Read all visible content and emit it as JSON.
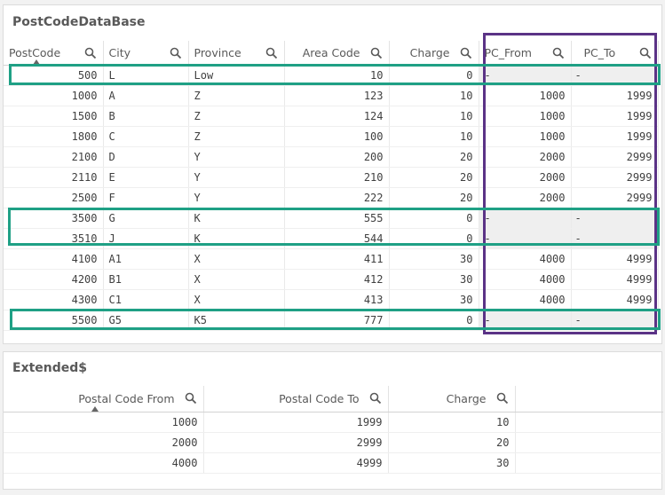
{
  "panel1": {
    "title": "PostCodeDataBase",
    "columns": [
      "PostCode",
      "City",
      "Province",
      "Area Code",
      "Charge",
      "PC_From",
      "PC_To"
    ],
    "rows": [
      [
        "500",
        "L",
        "Low",
        "10",
        "0",
        "-",
        "-"
      ],
      [
        "1000",
        "A",
        "Z",
        "123",
        "10",
        "1000",
        "1999"
      ],
      [
        "1500",
        "B",
        "Z",
        "124",
        "10",
        "1000",
        "1999"
      ],
      [
        "1800",
        "C",
        "Z",
        "100",
        "10",
        "1000",
        "1999"
      ],
      [
        "2100",
        "D",
        "Y",
        "200",
        "20",
        "2000",
        "2999"
      ],
      [
        "2110",
        "E",
        "Y",
        "210",
        "20",
        "2000",
        "2999"
      ],
      [
        "2500",
        "F",
        "Y",
        "222",
        "20",
        "2000",
        "2999"
      ],
      [
        "3500",
        "G",
        "K",
        "555",
        "0",
        "-",
        "-"
      ],
      [
        "3510",
        "J",
        "K",
        "544",
        "0",
        "-",
        "-"
      ],
      [
        "4100",
        "A1",
        "X",
        "411",
        "30",
        "4000",
        "4999"
      ],
      [
        "4200",
        "B1",
        "X",
        "412",
        "30",
        "4000",
        "4999"
      ],
      [
        "4300",
        "C1",
        "X",
        "413",
        "30",
        "4000",
        "4999"
      ],
      [
        "5500",
        "G5",
        "K5",
        "777",
        "0",
        "-",
        "-"
      ]
    ]
  },
  "panel2": {
    "title": "Extended$",
    "columns": [
      "Postal Code From",
      "Postal Code To",
      "Charge",
      ""
    ],
    "rows": [
      [
        "1000",
        "1999",
        "10",
        ""
      ],
      [
        "2000",
        "2999",
        "20",
        ""
      ],
      [
        "4000",
        "4999",
        "30",
        ""
      ]
    ]
  },
  "colors": {
    "highlight_green": "#1fa085",
    "highlight_purple": "#5b3386"
  },
  "icons": {
    "column_search": "search-icon",
    "sort_indicator": "sort-ascending-icon"
  }
}
